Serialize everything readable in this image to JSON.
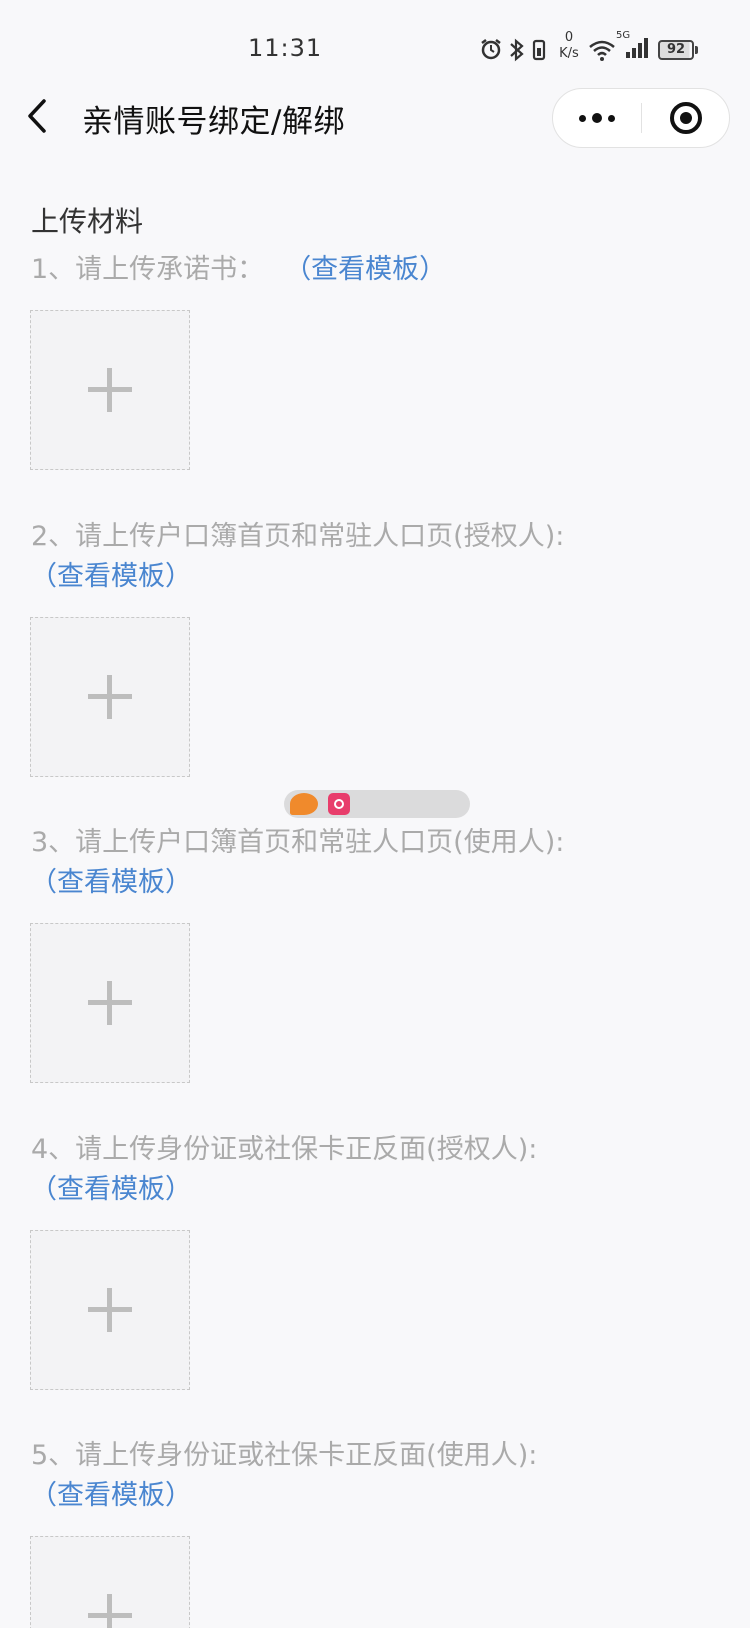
{
  "status_bar": {
    "time": "11:31",
    "net_speed_value": "0",
    "net_speed_unit": "K/s",
    "network_type": "5G",
    "battery": "92"
  },
  "nav": {
    "title": "亲情账号绑定/解绑"
  },
  "section": {
    "title": "上传材料"
  },
  "items": [
    {
      "label": "1、请上传承诺书：",
      "template_link": "（查看模板）"
    },
    {
      "label": "2、请上传户口簿首页和常驻人口页(授权人):",
      "template_link": "（查看模板）"
    },
    {
      "label": "3、请上传户口簿首页和常驻人口页(使用人):",
      "template_link": "（查看模板）"
    },
    {
      "label": "4、请上传身份证或社保卡正反面(授权人):",
      "template_link": "（查看模板）"
    },
    {
      "label": "5、请上传身份证或社保卡正反面(使用人):",
      "template_link": "（查看模板）"
    }
  ],
  "colors": {
    "link": "#4a86d0",
    "label": "#aaaaaa",
    "background": "#f8f8fa"
  }
}
